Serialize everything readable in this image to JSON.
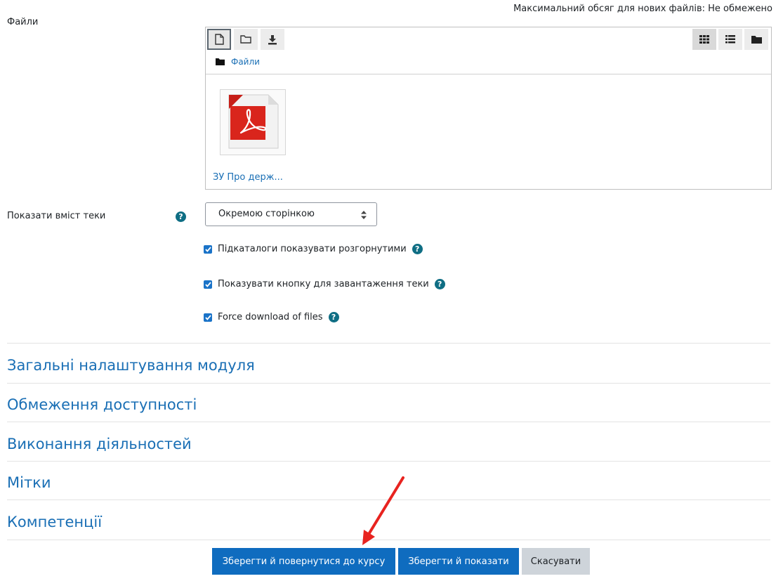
{
  "files_label": "Файли",
  "max_size_text": "Максимальний обсяг для нових файлів: Не обмежено",
  "filemanager": {
    "breadcrumb": "Файли",
    "file": {
      "name": "ЗУ Про держ...",
      "type_icon": "pdf-icon"
    }
  },
  "display": {
    "label": "Показати вміст теки",
    "selected": "Окремою сторінкою"
  },
  "checkboxes": [
    {
      "label": "Підкаталоги показувати розгорнутими",
      "checked": true
    },
    {
      "label": "Показувати кнопку для завантаження теки",
      "checked": true
    },
    {
      "label": "Force download of files",
      "checked": true
    }
  ],
  "sections": [
    "Загальні налаштування модуля",
    "Обмеження доступності",
    "Виконання діяльностей",
    "Мітки",
    "Компетенції"
  ],
  "buttons": {
    "save_return": "Зберегти й повернутися до курсу",
    "save_display": "Зберегти й показати",
    "cancel": "Скасувати"
  },
  "colors": {
    "accent": "#0f6cbf",
    "link": "#1a6fb5",
    "help": "#0f6e84",
    "annotation_arrow": "#e8231f"
  }
}
